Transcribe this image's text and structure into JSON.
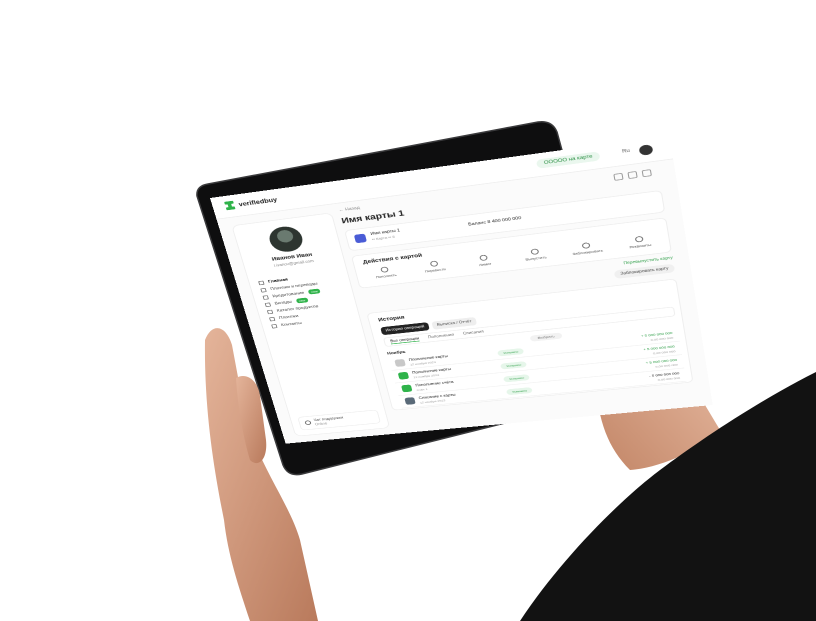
{
  "app": {
    "brand": "verifiedbuy",
    "status": "ООООО на карте",
    "lang": "Ru"
  },
  "profile": {
    "name": "Иванов Иван",
    "subtitle": "i.ivanov@gmail.com"
  },
  "nav": [
    {
      "label": "Главная",
      "active": true
    },
    {
      "label": "Платежи и переводы"
    },
    {
      "label": "Кредитование",
      "badge": "new"
    },
    {
      "label": "Вклады",
      "badge": "new"
    },
    {
      "label": "Каталог продуктов"
    },
    {
      "label": "Платежи"
    },
    {
      "label": "Контакты"
    }
  ],
  "support": {
    "title": "Чат поддержки",
    "subtitle": "Online"
  },
  "main": {
    "breadcrumb": "← Назад",
    "title": "Имя карты 1",
    "card": {
      "name": "Имя карты 1",
      "number": "•• Карта •• 8",
      "balance": "Баланс  8 400 000 000"
    },
    "actions_title": "Действия с картой",
    "actions": [
      "Пополнить",
      "Перевести",
      "Лимит",
      "Выпустить",
      "Заблокировать",
      "Реквизиты"
    ],
    "link_green": "Перевыпустить карту",
    "block_button": "Заблокировать карту",
    "history_title": "История",
    "segments": [
      "История операций",
      "Выписка / Отчёт"
    ],
    "tabs": [
      "Все операции",
      "Пополнения",
      "Списания"
    ],
    "month": "Ноябрь",
    "filter": "Выбрать",
    "transactions": [
      {
        "name": "Пополнение карты",
        "date": "12 ноября 2023",
        "status": "Успешно",
        "amount": "+ 5 000 000 000",
        "sub": "0,00 000 000",
        "color": "#c8c8c8"
      },
      {
        "name": "Пополнение карты",
        "date": "12 ноября 2023",
        "status": "Успешно",
        "amount": "+ 5 000 000 000",
        "sub": "0,00 000 000",
        "color": "#2fb34a"
      },
      {
        "name": "Пополнение счёта",
        "date": "Счёт 1",
        "status": "Успешно",
        "amount": "+ 5 000 000 000",
        "sub": "0,00 000 000",
        "color": "#2fb34a"
      },
      {
        "name": "Списание с карты",
        "date": "12 ноября 2023",
        "status": "Успешно",
        "amount": "- 5 000 000 000",
        "sub": "0,00 000 000",
        "color": "#5a6a78"
      }
    ]
  },
  "colors": {
    "accent": "#2fb34a",
    "device": "#111111",
    "skin": "#d9a489"
  }
}
